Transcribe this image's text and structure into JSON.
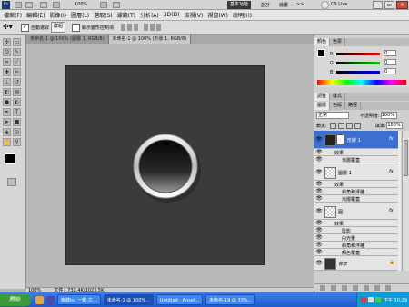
{
  "appbar": {
    "zoom": "100%",
    "workspace": "基本功能",
    "ws2": "設計",
    "ws3": "繪畫",
    "ws4": ">>",
    "cslive": "CS Live"
  },
  "menu": [
    "檔案(F)",
    "編輯(E)",
    "影像(I)",
    "圖層(L)",
    "選取(S)",
    "濾鏡(T)",
    "分析(A)",
    "3D(D)",
    "檢視(V)",
    "視窗(W)",
    "說明(H)"
  ],
  "options": {
    "auto_select_label": "自動選取",
    "auto_select_value": "群組",
    "transform_label": "顯示變形控制項"
  },
  "tabs": [
    {
      "label": "未命名-1 @ 100% (圖層 1, RGB/8)"
    },
    {
      "label": "未命名-1 @ 100% (形狀 1, RGB/8)"
    }
  ],
  "status": {
    "zoom": "100%",
    "doc": "文件：732.4K/1023.5K"
  },
  "panels": {
    "color_tabs": [
      "顏色",
      "色票"
    ],
    "color": {
      "r": "R",
      "g": "G",
      "b": "B",
      "r_val": "0",
      "g_val": "0",
      "b_val": "0"
    },
    "adjust_tabs": [
      "調整",
      "樣式"
    ],
    "layer_tabs": [
      "圖層",
      "色版",
      "路徑"
    ],
    "blend_mode": "正常",
    "opacity_label": "不透明度:",
    "opacity": "100%",
    "lock_label": "鎖定:",
    "fill_label": "填滿:",
    "fill": "100%",
    "layers": [
      {
        "name": "形狀 1",
        "fx": "fx",
        "effects_label": "效果",
        "effects": [
          "漸層覆蓋"
        ]
      },
      {
        "name": "圖層 1",
        "fx": "fx",
        "effects_label": "效果",
        "effects": [
          "斜角和浮雕",
          "漸層覆蓋"
        ]
      },
      {
        "name": "圓",
        "fx": "fx",
        "effects_label": "效果",
        "effects": [
          "陰影",
          "內光暈",
          "斜角和浮雕",
          "顏色覆蓋"
        ]
      },
      {
        "name": "背景",
        "lock": "🔒"
      }
    ]
  },
  "taskbar": {
    "start": "開始",
    "items": [
      "簡體to..一鍵-文...",
      "未命名-1 @ 100%...",
      "Untitled - Ansel...",
      "未命名-19 @ 33%..."
    ],
    "time": "下午 10:29"
  },
  "colors": {
    "doc_bg": "#3b3b3b",
    "selected_layer": "#3d6fd1",
    "taskbar": "#245edb"
  }
}
